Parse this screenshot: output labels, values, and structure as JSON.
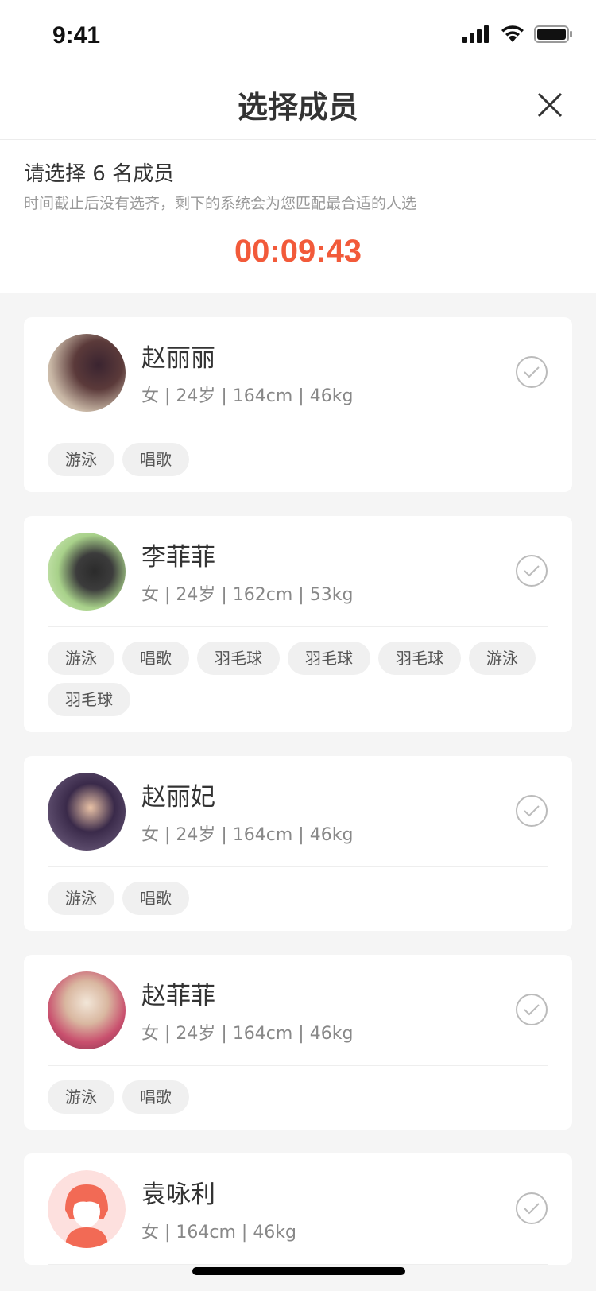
{
  "status": {
    "time": "9:41"
  },
  "nav": {
    "title": "选择成员"
  },
  "intro": {
    "title": "请选择 6 名成员",
    "subtitle": "时间截止后没有选齐，剩下的系统会为您匹配最合适的人选",
    "countdown": "00:09:43"
  },
  "members": [
    {
      "name": "赵丽丽",
      "meta": "女 | 24岁 | 164cm | 46kg",
      "tags": [
        "游泳",
        "唱歌"
      ]
    },
    {
      "name": "李菲菲",
      "meta": "女 | 24岁 | 162cm | 53kg",
      "tags": [
        "游泳",
        "唱歌",
        "羽毛球",
        "羽毛球",
        "羽毛球",
        "游泳",
        "羽毛球"
      ]
    },
    {
      "name": "赵丽妃",
      "meta": "女 | 24岁 | 164cm | 46kg",
      "tags": [
        "游泳",
        "唱歌"
      ]
    },
    {
      "name": "赵菲菲",
      "meta": "女 | 24岁 | 164cm | 46kg",
      "tags": [
        "游泳",
        "唱歌"
      ]
    },
    {
      "name": "袁咏利",
      "meta": "女 | 164cm | 46kg",
      "tags": []
    }
  ],
  "colors": {
    "accent": "#f25a3a",
    "tag_bg": "#f0f0f0"
  }
}
